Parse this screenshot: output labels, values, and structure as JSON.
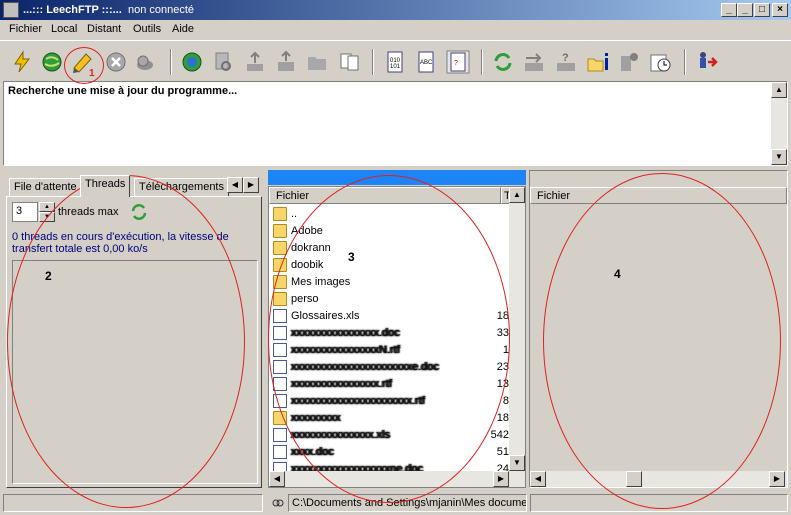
{
  "window": {
    "title": "...::: LeechFTP :::...",
    "status": "non connecté",
    "controls": [
      "_",
      "□",
      "×"
    ]
  },
  "menu": [
    "Fichier",
    "Local",
    "Distant",
    "Outils",
    "Aide"
  ],
  "toolbar": {
    "icons": [
      "lightning-icon",
      "globe-icon",
      "pencil-icon",
      "stop-icon",
      "snail-icon",
      "globe-refresh-icon",
      "file-search-icon",
      "upload-icon",
      "upload-stack-icon",
      "folder-icon",
      "copy-icon",
      "binary-icon",
      "ascii-icon",
      "auto-mode-icon",
      "sync-icon",
      "transfer-icon",
      "question-icon",
      "folder-info-icon",
      "info-icon",
      "schedule-icon",
      "exit-icon"
    ]
  },
  "log": {
    "message": "Recherche une mise à jour du programme..."
  },
  "left_panel": {
    "tabs": [
      "File d'attente",
      "Threads",
      "Téléchargements"
    ],
    "active_tab": "Threads",
    "threads_value": "3",
    "threads_label": "threads max",
    "status": "0 threads en cours d'exécution, la vitesse de transfert totale est 0,00 ko/s"
  },
  "middle_panel": {
    "columns": [
      "Fichier",
      "T"
    ],
    "rows": [
      {
        "type": "up",
        "name": "..",
        "size": ""
      },
      {
        "type": "folder",
        "name": "Adobe",
        "size": ""
      },
      {
        "type": "folder",
        "name": "dokrann",
        "size": ""
      },
      {
        "type": "folder",
        "name": "doobik",
        "size": ""
      },
      {
        "type": "folder",
        "name": "Mes images",
        "size": ""
      },
      {
        "type": "folder",
        "name": "perso",
        "size": ""
      },
      {
        "type": "doc",
        "name": "Glossaires.xls",
        "size": "18"
      },
      {
        "type": "doc",
        "name": "xxxxxxxxxxxxxxxx.doc",
        "size": "33"
      },
      {
        "type": "doc",
        "name": "xxxxxxxxxxxxxxxxN.rtf",
        "size": "1"
      },
      {
        "type": "doc",
        "name": "xxxxxxxxxxxxxxxxxxxxxxe.doc",
        "size": "23"
      },
      {
        "type": "doc",
        "name": "xxxxxxxxxxxxxxxx.rtf",
        "size": "13"
      },
      {
        "type": "doc",
        "name": "xxxxxxxxxxxxxxxxxxxxxx.rtf",
        "size": "8"
      },
      {
        "type": "folder",
        "name": "xxxxxxxxx",
        "size": "18"
      },
      {
        "type": "doc",
        "name": "xxxxxxxxxxxxxxx.xls",
        "size": "542"
      },
      {
        "type": "doc",
        "name": "xxxx.doc",
        "size": "51"
      },
      {
        "type": "doc",
        "name": "xxxxxxxxxxxxxxxxxxne.doc",
        "size": "24"
      }
    ],
    "path": "C:\\Documents and Settings\\mjanin\\Mes documents"
  },
  "right_panel": {
    "columns": [
      "Fichier"
    ]
  },
  "annotations": [
    "1",
    "2",
    "3",
    "4"
  ]
}
